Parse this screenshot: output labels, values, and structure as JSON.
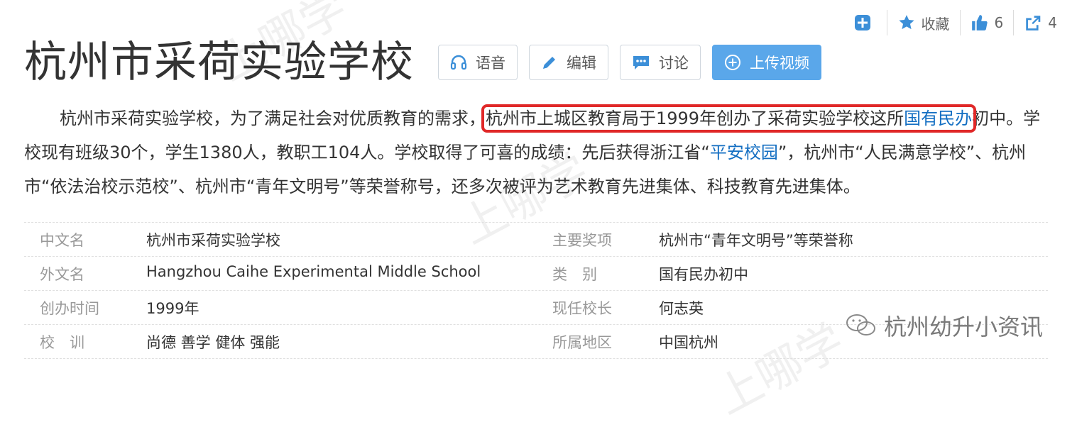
{
  "toolbar": {
    "favorite_label": "收藏",
    "like_count": "6",
    "share_count": "4"
  },
  "page_title": "杭州市采荷实验学校",
  "actions": {
    "audio": "语音",
    "edit": "编辑",
    "discuss": "讨论",
    "upload_video": "上传视频"
  },
  "summary": {
    "part1": "杭州市采荷实验学校，为了满足社会对优质教育的需求，",
    "highlight": "杭州市上城区教育局于1999年创办了采荷实验学校这所",
    "link1": "国有民办",
    "part2": "初中。学校现有班级30个，学生1380人，教职工104人。学校取得了可喜的成绩：先后获得浙江省“",
    "link2": "平安校园",
    "part3": "”，杭州市“人民满意学校”、杭州市“依法治校示范校”、杭州市“青年文明号”等荣誉称号，还多次被评为艺术教育先进集体、科技教育先进集体。"
  },
  "info": [
    {
      "l_label": "中文名",
      "l_value": "杭州市采荷实验学校",
      "r_label": "主要奖项",
      "r_value": "杭州市“青年文明号”等荣誉称"
    },
    {
      "l_label": "外文名",
      "l_value": "Hangzhou Caihe Experimental Middle School",
      "r_label": "类　别",
      "r_value": "国有民办初中"
    },
    {
      "l_label": "创办时间",
      "l_value": "1999年",
      "r_label": "现任校长",
      "r_value": "何志英"
    },
    {
      "l_label": "校　训",
      "l_value": "尚德 善学 健体 强能",
      "r_label": "所属地区",
      "r_value": "中国杭州"
    }
  ],
  "watermark": "杭州幼升小资讯",
  "colors": {
    "link": "#136ec2",
    "highlight_box": "#e02828",
    "primary_button": "#5aa7ea",
    "toolbar_icon": "#3c8fd8"
  }
}
